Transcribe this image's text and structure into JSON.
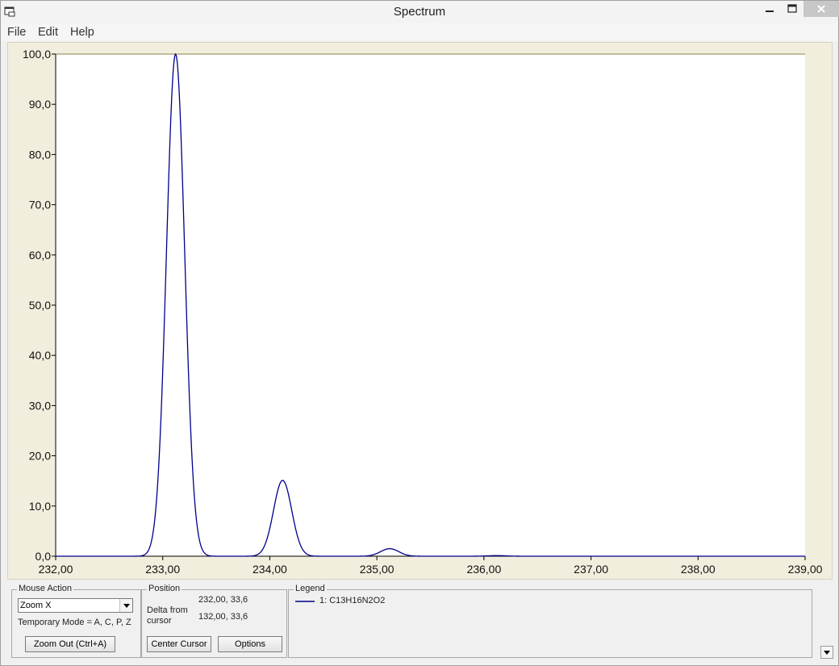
{
  "window": {
    "title": "Spectrum",
    "icon": "app-window-icon",
    "controls": [
      "minimize-icon",
      "maximize-icon",
      "close-icon"
    ]
  },
  "menu": {
    "items": [
      "File",
      "Edit",
      "Help"
    ]
  },
  "chart_data": {
    "type": "line",
    "title": "",
    "xlabel": "",
    "ylabel": "",
    "xlim": [
      232.0,
      239.0
    ],
    "ylim": [
      0.0,
      100.0
    ],
    "x_ticks": [
      "232,00",
      "233,00",
      "234,00",
      "235,00",
      "236,00",
      "237,00",
      "238,00",
      "239,00"
    ],
    "y_ticks": [
      "0,0",
      "10,0",
      "20,0",
      "30,0",
      "40,0",
      "50,0",
      "60,0",
      "70,0",
      "80,0",
      "90,0",
      "100,0"
    ],
    "grid": false,
    "line_color": "#00008b",
    "peaks": [
      {
        "x": 233.12,
        "y": 100.0,
        "width": 0.085
      },
      {
        "x": 234.12,
        "y": 15.1,
        "width": 0.085
      },
      {
        "x": 235.12,
        "y": 1.5,
        "width": 0.085
      },
      {
        "x": 236.12,
        "y": 0.12,
        "width": 0.085
      }
    ],
    "series": [
      {
        "name": "1: C13H16N2O2",
        "color": "#00008b"
      }
    ]
  },
  "mouse_action": {
    "title": "Mouse Action",
    "selected": "Zoom X",
    "temporary_mode": "Temporary Mode = A, C, P, Z",
    "zoom_out_label": "Zoom Out (Ctrl+A)"
  },
  "position": {
    "title": "Position",
    "value": "232,00, 33,6",
    "delta_label": "Delta from cursor",
    "delta_value": "132,00, 33,6",
    "center_cursor_label": "Center Cursor",
    "options_label": "Options"
  },
  "legend": {
    "title": "Legend",
    "entry": "1: C13H16N2O2",
    "color": "#00008b"
  }
}
